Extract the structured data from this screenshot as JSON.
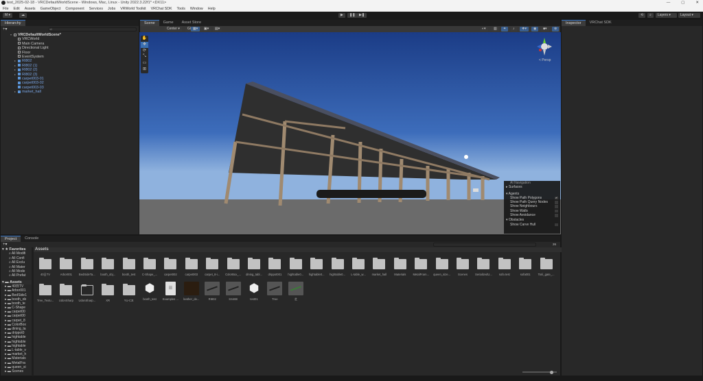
{
  "window": {
    "title": "test_2025-02-18 - VRCDefaultWorldScene - Windows, Mac, Linux - Unity 2022.3.22f1* <DX11>",
    "controls": [
      "—",
      "▢",
      "✕"
    ]
  },
  "menu": [
    "File",
    "Edit",
    "Assets",
    "GameObject",
    "Component",
    "Services",
    "Jobs",
    "VRWorld Toolkit",
    "VRChat SDK",
    "Tools",
    "Window",
    "Help"
  ],
  "toolbar": {
    "account": "M ▾",
    "cloud": "☁",
    "play": "▶",
    "pause": "❚❚",
    "step": "▶❚",
    "layers": "Layers",
    "layout": "Layout"
  },
  "hierarchy": {
    "tab": "Hierarchy",
    "add": "+▾",
    "search_placeholder": "All",
    "scene": "VRCDefaultWorldScene*",
    "items": [
      {
        "label": "VRCWorld",
        "prefab": false,
        "expand": false
      },
      {
        "label": "Main Camera",
        "prefab": false,
        "expand": false
      },
      {
        "label": "Directional Light",
        "prefab": false,
        "expand": false
      },
      {
        "label": "Floor",
        "prefab": false,
        "expand": false
      },
      {
        "label": "EventSystem",
        "prefab": false,
        "expand": false
      },
      {
        "label": "RI802",
        "prefab": true,
        "expand": true
      },
      {
        "label": "RI802 (1)",
        "prefab": true,
        "expand": true
      },
      {
        "label": "RI802 (2)",
        "prefab": true,
        "expand": true
      },
      {
        "label": "RI802 (3)",
        "prefab": true,
        "expand": true
      },
      {
        "label": "carpet003-01",
        "prefab": true,
        "expand": false
      },
      {
        "label": "carpet003-02",
        "prefab": true,
        "expand": false
      },
      {
        "label": "carpet003-03",
        "prefab": true,
        "expand": false
      },
      {
        "label": "market_hall",
        "prefab": true,
        "expand": true
      }
    ]
  },
  "scene": {
    "tabs": [
      "Scene",
      "Game",
      "Asset Store"
    ],
    "pivot": "Center ▾",
    "space": "Global ▾",
    "persp": "< Persp"
  },
  "ai_nav": {
    "title": "AI Navigation",
    "surfaces": "Surfaces",
    "agents": "Agents",
    "agent_options": [
      {
        "label": "Show Path Polygons",
        "checked": true
      },
      {
        "label": "Show Path Query Nodes",
        "checked": false
      },
      {
        "label": "Show Neighbours",
        "checked": false
      },
      {
        "label": "Show Walls",
        "checked": false
      },
      {
        "label": "Show Avoidance",
        "checked": false
      }
    ],
    "obstacles": "Obstacles",
    "obstacle_options": [
      {
        "label": "Show Carve Hull",
        "checked": false
      }
    ]
  },
  "inspector": {
    "tabs": [
      "Inspector",
      "VRChat SDK"
    ]
  },
  "project": {
    "tabs": [
      "Project",
      "Console"
    ],
    "add": "+▾",
    "favorites": "Favorites",
    "fav_items": [
      "All Modifi",
      "All Confi",
      "All Exclu",
      "All Mater",
      "All Mode",
      "All Prefat"
    ],
    "assets_root": "Assets",
    "tree": [
      "40日TV",
      "Arbor001",
      "BedSide1",
      "booth_ob",
      "booth_te",
      "C-Shape",
      "carpet00",
      "carpet00",
      "carpet_8",
      "ColorBox",
      "dining_ta",
      "drippot0",
      "hightable",
      "hightable",
      "hightable",
      "L-table_v",
      "market_h",
      "Materials",
      "MetalFra",
      "queen_si",
      "Scenes"
    ],
    "breadcrumb": "Assets",
    "count": "26",
    "row1": [
      "40日TV",
      "Arbor001",
      "BedSideTa...",
      "booth_obj...",
      "booth_test",
      "C-Shape_...",
      "carpet002",
      "carpet003",
      "carpet_8-i...",
      "ColorBox_...",
      "dining_tabl...",
      "drippot001",
      "hightable0...",
      "hightable0...",
      "hightable0...",
      "L-table_w...",
      "market_hall",
      "Materials",
      "MetalFram...",
      "queen_size...",
      "Scenes",
      "SerializedU...",
      "sofa test",
      "sofa001",
      "Torii_gate_..."
    ],
    "row2": [
      {
        "label": "Tree_Textu...",
        "kind": "folder"
      },
      {
        "label": "UdonSharp",
        "kind": "folder"
      },
      {
        "label": "UdonSharp...",
        "kind": "folder-empty"
      },
      {
        "label": "XR",
        "kind": "folder"
      },
      {
        "label": "YU-C3t",
        "kind": "folder"
      },
      {
        "label": "booth_test",
        "kind": "unity"
      },
      {
        "label": "Examples ...",
        "kind": "doc"
      },
      {
        "label": "leather_de...",
        "kind": "texture"
      },
      {
        "label": "RI802",
        "kind": "prefab"
      },
      {
        "label": "SS488",
        "kind": "prefab"
      },
      {
        "label": "test01",
        "kind": "unity"
      },
      {
        "label": "Tree",
        "kind": "prefab"
      },
      {
        "label": "芝",
        "kind": "grass"
      }
    ]
  }
}
